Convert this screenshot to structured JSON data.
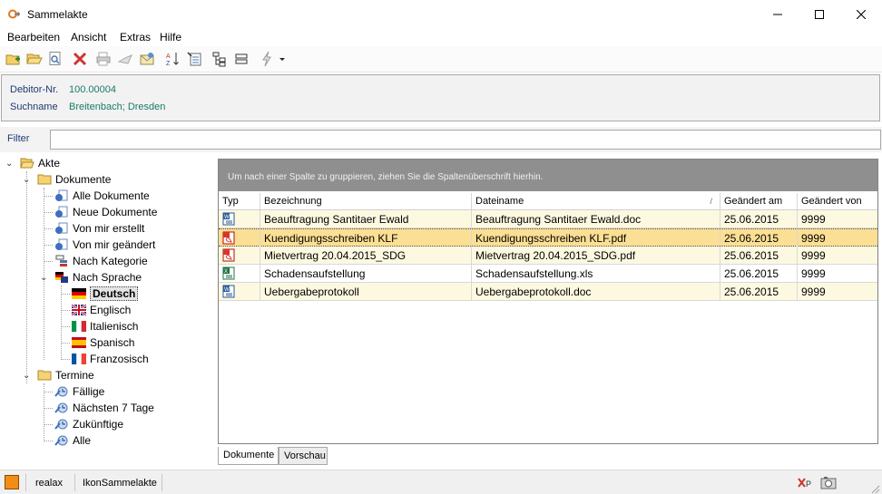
{
  "window": {
    "title": "Sammelakte",
    "app_icon": "gear-arrow-icon"
  },
  "menu": {
    "items": [
      "Bearbeiten",
      "Ansicht",
      "Extras",
      "Hilfe"
    ]
  },
  "toolbar": {
    "buttons": [
      "new-folder-icon",
      "open-folder-icon",
      "preview-icon",
      "delete-icon",
      "print-icon",
      "send-icon",
      "mail-icon",
      "sort-az-icon",
      "properties-icon",
      "tree-icon",
      "collapse-icon",
      "action-icon"
    ]
  },
  "info": {
    "debitor_label": "Debitor-Nr.",
    "debitor_value": "100.00004",
    "suchname_label": "Suchname",
    "suchname_value": "Breitenbach; Dresden"
  },
  "filter": {
    "label": "Filter",
    "value": ""
  },
  "tree": {
    "root": "Akte",
    "dokumente": "Dokumente",
    "alle_dokumente": "Alle Dokumente",
    "neue_dokumente": "Neue Dokumente",
    "von_mir_erstellt": "Von mir erstellt",
    "von_mir_geaendert": "Von mir geändert",
    "nach_kategorie": "Nach Kategorie",
    "nach_sprache": "Nach Sprache",
    "deutsch": "Deutsch",
    "englisch": "Englisch",
    "italienisch": "Italienisch",
    "spanisch": "Spanisch",
    "franzosisch": "Franzosisch",
    "termine": "Termine",
    "faellige": "Fällige",
    "naechsten": "Nächsten 7 Tage",
    "zukuenftige": "Zukünftige",
    "alle": "Alle"
  },
  "grid": {
    "group_hint": "Um nach einer Spalte zu gruppieren, ziehen Sie die Spaltenüberschrift hierhin.",
    "columns": {
      "typ": "Typ",
      "bezeichnung": "Bezeichnung",
      "dateiname": "Dateiname",
      "geaendert_am": "Geändert am",
      "geaendert_von": "Geändert von"
    },
    "rows": [
      {
        "type": "word",
        "bezeichnung": "Beauftragung Santitaer Ewald",
        "dateiname": "Beauftragung Santitaer Ewald.doc",
        "geaendert_am": "25.06.2015",
        "geaendert_von": "9999"
      },
      {
        "type": "pdf",
        "bezeichnung": "Kuendigungsschreiben KLF",
        "dateiname": "Kuendigungsschreiben KLF.pdf",
        "geaendert_am": "25.06.2015",
        "geaendert_von": "9999"
      },
      {
        "type": "pdf",
        "bezeichnung": "Mietvertrag 20.04.2015_SDG",
        "dateiname": "Mietvertrag 20.04.2015_SDG.pdf",
        "geaendert_am": "25.06.2015",
        "geaendert_von": "9999"
      },
      {
        "type": "excel",
        "bezeichnung": "Schadensaufstellung",
        "dateiname": "Schadensaufstellung.xls",
        "geaendert_am": "25.06.2015",
        "geaendert_von": "9999"
      },
      {
        "type": "word",
        "bezeichnung": "Uebergabeprotokoll",
        "dateiname": "Uebergabeprotokoll.doc",
        "geaendert_am": "25.06.2015",
        "geaendert_von": "9999"
      }
    ]
  },
  "tabs": [
    "Dokumente",
    "Vorschau"
  ],
  "status": {
    "user": "realax",
    "module": "IkonSammelakte"
  },
  "colors": {
    "row_alt": "#fdf9e1",
    "row_selected": "#fbdf94",
    "group_box": "#8f8f8f",
    "status_accent": "#f28c14"
  }
}
